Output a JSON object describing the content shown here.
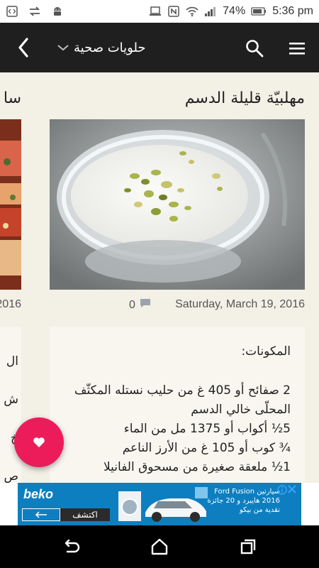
{
  "status_bar": {
    "battery_percent": "74%",
    "time": "5:36 pm",
    "icons": [
      "code-icon",
      "sync-icon",
      "android-icon",
      "laptop-icon",
      "nfc-icon",
      "wifi-icon",
      "signal-icon",
      "battery-icon"
    ]
  },
  "app_bar": {
    "category_label": "حلويات صحية",
    "icons": [
      "back-icon",
      "chevron-down-icon",
      "search-icon",
      "menu-icon"
    ]
  },
  "article": {
    "title": "مهلبيّة قليلة الدسم",
    "date": "Saturday, March 19, 2016",
    "comment_count": "0",
    "ingredients_heading": "المكونات:",
    "ingredients": [
      "2 صفائح أو 405 غ من حليب نستله المكثّف المحلّى خالي الدسم",
      "5½ أكواب أو 1375 مل من الماء",
      "¾ كوب أو 105 غ من الأرز الناعم",
      "1½ ملعقة صغيرة من مسحوق الفانيلا"
    ]
  },
  "side_article": {
    "title_fragment": "سا",
    "year_fragment": "2016",
    "text_fragments": [
      "ال",
      "ش",
      "خ",
      "ص"
    ]
  },
  "ad": {
    "brand": "beko",
    "cta": "اكتشف",
    "text": "سيارتين Ford Fusion 2016 هايبرد و 20 جائزة نقدية من بيكو"
  },
  "colors": {
    "app_bar": "#1f1f1f",
    "fab": "#ec1c5a",
    "background": "#f3f0e6",
    "ad_blue": "#0d7fc0"
  }
}
